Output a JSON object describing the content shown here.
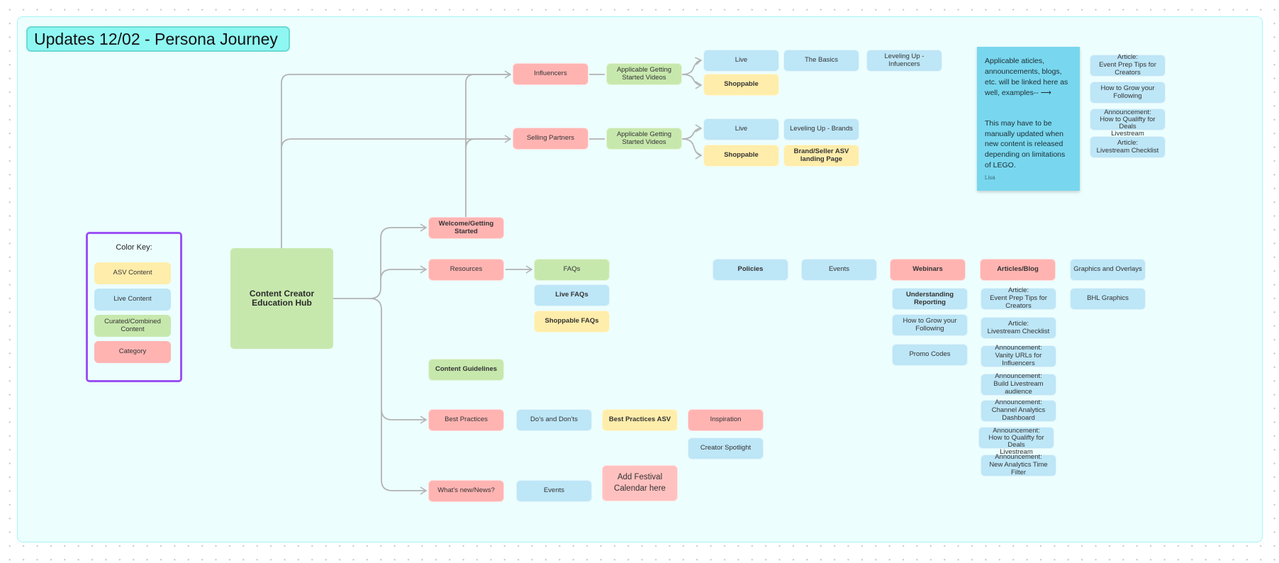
{
  "title": "Updates 12/02 - Persona Journey",
  "colors": {
    "category": "#ffb4b2",
    "live": "#bde6f7",
    "asv": "#ffedab",
    "curated": "#c7e8ad",
    "note": "#78d7ee",
    "board": "#ecfefe",
    "title_badge": "#8ff7f2",
    "key_frame_border": "#9b51f5",
    "connector": "#b3b3b3"
  },
  "color_key": {
    "title": "Color Key:",
    "items": [
      {
        "label": "ASV Content",
        "type": "asv"
      },
      {
        "label": "Live Content",
        "type": "live"
      },
      {
        "label": "Curated/Combined\nContent",
        "type": "curated"
      },
      {
        "label": "Category",
        "type": "category"
      }
    ]
  },
  "hub": {
    "label": "Content Creator\nEducation Hub"
  },
  "personas": {
    "influencers": {
      "label": "Influencers",
      "videos": "Applicable Getting\nStarted Videos",
      "live": "Live",
      "live_children": [
        "The Basics",
        "Leveling Up - Infuencers"
      ],
      "shoppable": "Shoppable"
    },
    "selling_partners": {
      "label": "Selling Partners",
      "videos": "Applicable Getting\nStarted Videos",
      "live": "Live",
      "live_children": [
        "Leveling Up - Brands"
      ],
      "shoppable": "Shoppable",
      "shoppable_children": [
        "Brand/Seller ASV\nlanding Page"
      ]
    }
  },
  "note": {
    "paragraph1": "Applicable aticles, announcements, blogs, etc. will be linked here as well, examples-- ⟶",
    "paragraph2": "This may have to be manually updated when new content is released depending on limitations of LEGO.",
    "author": "Lisa"
  },
  "note_examples": [
    "Article:\nEvent Prep Tips for Creators",
    "How to Grow your Following",
    "Announcement:\nHow to Qualifty for Deals\nLivestream",
    "Article:\nLivestream Checklist"
  ],
  "categories": {
    "welcome": "Welcome/Getting Started",
    "resources": {
      "label": "Resources",
      "faqs": "FAQs",
      "live_faqs": "Live FAQs",
      "shoppable_faqs": "Shoppable FAQs"
    },
    "content_guidelines": "Content Guidelines",
    "best_practices": {
      "label": "Best Practices",
      "dos_donts": "Do’s and Don’ts",
      "asv": "Best Practices ASV",
      "inspiration": "Inspiration",
      "creator_spotlight": "Creator Spotlight"
    },
    "whats_new": {
      "label": "What’s new/News?",
      "events": "Events",
      "festival": "Add Festival\nCalendar here"
    }
  },
  "resources_row": {
    "policies": "Policies",
    "events": "Events",
    "webinars": {
      "label": "Webinars",
      "items": [
        "Understanding Reporting",
        "How to Grow your Following",
        "Promo Codes"
      ]
    },
    "articles": {
      "label": "Articles/Blog",
      "items": [
        "Article:\nEvent Prep Tips for Creators",
        "Article:\nLivestream Checklist",
        "Announcement:\nVanity URLs for Influencers",
        "Announcement:\nBuild Livestream audience",
        "Announcement:\nChannel Analytics Dashboard",
        "Announcement:\nHow to Qualifty for Deals\nLivestream",
        "Announcement:\nNew Analytics Time Filter"
      ]
    },
    "graphics": {
      "label": "Graphics and Overlays",
      "items": [
        "BHL Graphics"
      ]
    }
  }
}
